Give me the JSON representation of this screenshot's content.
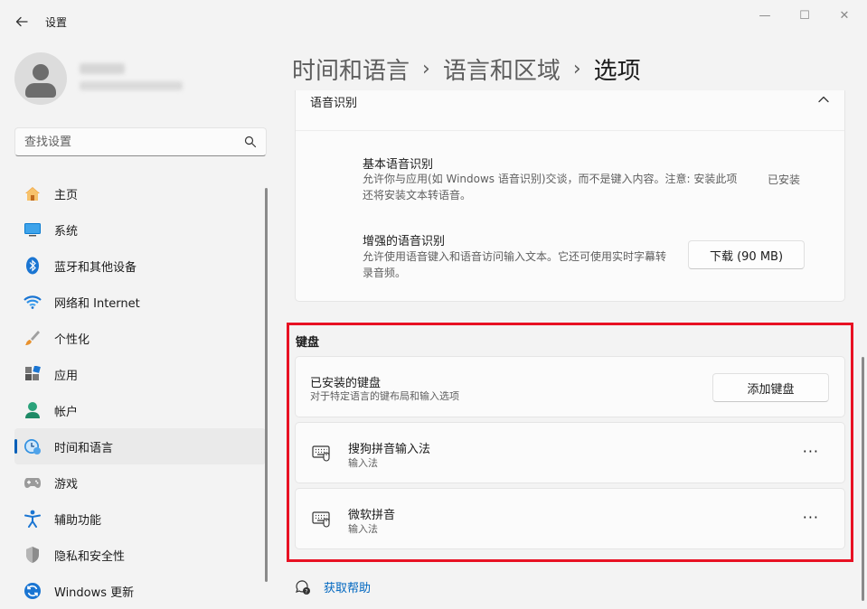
{
  "window": {
    "title": "设置",
    "controls": {
      "minimize": "—",
      "maximize": "☐",
      "close": "✕"
    }
  },
  "colors": {
    "accent": "#005fb8",
    "highlight": "#e81123",
    "link": "#0067c0"
  },
  "search": {
    "placeholder": "查找设置"
  },
  "sidebar": {
    "items": [
      {
        "label": "主页",
        "icon": "home-icon"
      },
      {
        "label": "系统",
        "icon": "system-icon"
      },
      {
        "label": "蓝牙和其他设备",
        "icon": "bluetooth-icon"
      },
      {
        "label": "网络和 Internet",
        "icon": "wifi-icon"
      },
      {
        "label": "个性化",
        "icon": "brush-icon"
      },
      {
        "label": "应用",
        "icon": "apps-icon"
      },
      {
        "label": "帐户",
        "icon": "account-icon"
      },
      {
        "label": "时间和语言",
        "icon": "time-language-icon",
        "active": true
      },
      {
        "label": "游戏",
        "icon": "gamepad-icon"
      },
      {
        "label": "辅助功能",
        "icon": "accessibility-icon"
      },
      {
        "label": "隐私和安全性",
        "icon": "shield-icon"
      },
      {
        "label": "Windows 更新",
        "icon": "update-icon"
      }
    ]
  },
  "breadcrumb": {
    "items": [
      "时间和语言",
      "语言和区域",
      "选项"
    ],
    "separator": "›"
  },
  "speech": {
    "header": "语音识别",
    "basic": {
      "title": "基本语音识别",
      "desc": "允许你与应用(如 Windows 语音识别)交谈，而不是键入内容。注意: 安装此项还将安装文本转语音。",
      "status": "已安装"
    },
    "enhanced": {
      "title": "增强的语音识别",
      "desc": "允许使用语音键入和语音访问输入文本。它还可使用实时字幕转录音频。",
      "button": "下载 (90 MB)"
    }
  },
  "keyboards": {
    "section_title": "键盘",
    "installed": {
      "title": "已安装的键盘",
      "desc": "对于特定语言的键布局和输入选项",
      "button": "添加键盘"
    },
    "items": [
      {
        "name": "搜狗拼音输入法",
        "type": "输入法",
        "more": "···"
      },
      {
        "name": "微软拼音",
        "type": "输入法",
        "more": "···"
      }
    ]
  },
  "help": {
    "label": "获取帮助"
  }
}
